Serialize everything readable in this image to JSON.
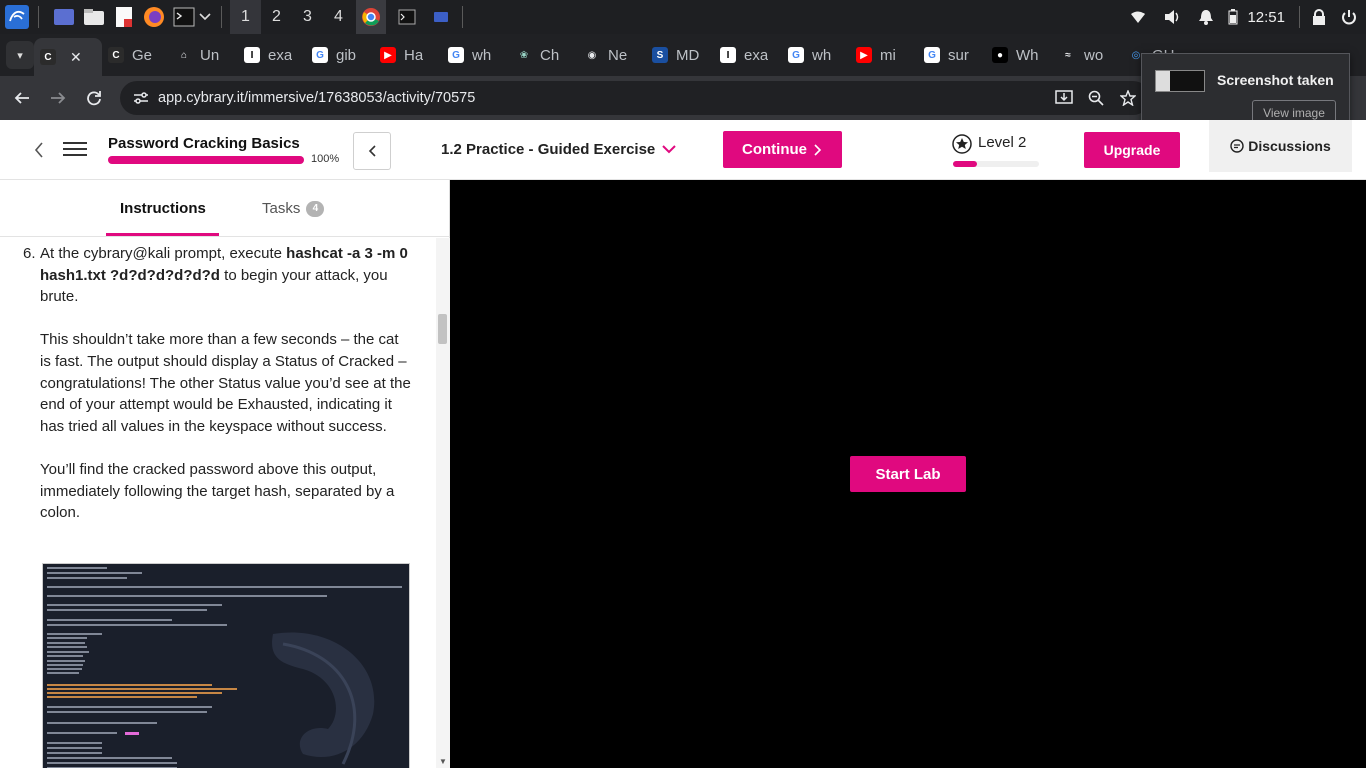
{
  "taskbar": {
    "workspaces": [
      "1",
      "2",
      "3",
      "4"
    ],
    "clock": "12:51"
  },
  "browser": {
    "tabs": [
      {
        "label": "",
        "favicon": "cybrary-icon",
        "active": true
      },
      {
        "label": "Ge",
        "favicon": "cybrary-icon"
      },
      {
        "label": "Un",
        "favicon": "user-icon"
      },
      {
        "label": "exa",
        "favicon": "instapaper-icon"
      },
      {
        "label": "gib",
        "favicon": "google-icon"
      },
      {
        "label": "Ha",
        "favicon": "youtube-icon"
      },
      {
        "label": "wh",
        "favicon": "google-icon"
      },
      {
        "label": "Ch",
        "favicon": "chatgpt-icon"
      },
      {
        "label": "Ne",
        "favicon": "globe-icon"
      },
      {
        "label": "MD",
        "favicon": "sans-icon"
      },
      {
        "label": "exa",
        "favicon": "instapaper-icon"
      },
      {
        "label": "wh",
        "favicon": "google-icon"
      },
      {
        "label": "mi",
        "favicon": "youtube-icon"
      },
      {
        "label": "sur",
        "favicon": "google-icon"
      },
      {
        "label": "Wh",
        "favicon": "medium-icon"
      },
      {
        "label": "wo",
        "favicon": "kali-icon"
      },
      {
        "label": "GH",
        "favicon": "github-icon"
      }
    ],
    "url": "app.cybrary.it/immersive/17638053/activity/70575"
  },
  "notification": {
    "title": "Screenshot taken",
    "button": "View image"
  },
  "header": {
    "course_title": "Password Cracking Basics",
    "progress_label": "100%",
    "progress_value": 1.0,
    "activity_title": "1.2 Practice - Guided Exercise",
    "continue_label": "Continue",
    "level_label": "Level 2",
    "level_progress": 0.28,
    "upgrade_label": "Upgrade",
    "discussions_label": "Discussions"
  },
  "panel": {
    "tabs": [
      {
        "label": "Instructions"
      },
      {
        "label": "Tasks",
        "count": "4"
      }
    ],
    "step_number": "6.",
    "step_intro": "At the cybrary@kali prompt, execute ",
    "step_command": "hashcat -a 3 -m 0 hash1.txt ?d?d?d?d?d?d",
    "step_outro": " to begin your attack, you brute.",
    "para_2": "This shouldn’t take more than a few seconds – the cat is fast. The output should display a Status of Cracked – congratulations! The other Status value you’d see at the end of your attempt would be Exhausted, indicating it has tried all values in the keyspace without success.",
    "para_3": "You’ll find the cracked password above this output, immediately following the target hash, separated by a colon."
  },
  "lab": {
    "start_label": "Start Lab"
  },
  "colors": {
    "accent": "#e0097f",
    "lab_bg": "#000000",
    "browser_dark": "#202124"
  }
}
